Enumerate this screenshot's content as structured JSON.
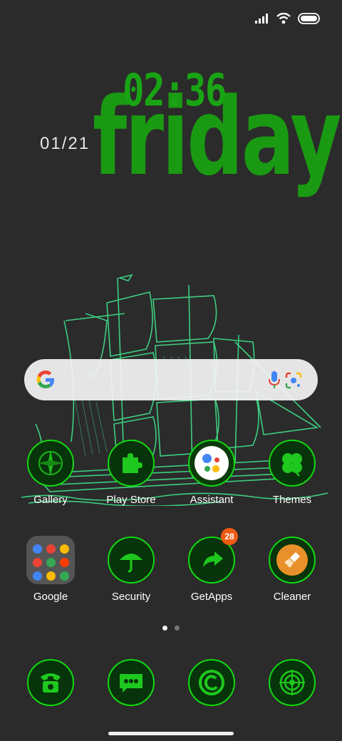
{
  "status_bar": {
    "signal": "signal-icon",
    "wifi": "wifi-icon",
    "battery": "battery-icon"
  },
  "clock": {
    "time": "02:36",
    "day": "friday",
    "date": "01/21"
  },
  "search": {
    "google_icon": "google-g-icon",
    "mic_icon": "mic-icon",
    "lens_icon": "lens-icon"
  },
  "row1": [
    {
      "label": "Gallery",
      "icon": "compass-icon"
    },
    {
      "label": "Play Store",
      "icon": "puzzle-icon"
    },
    {
      "label": "Assistant",
      "icon": "assistant-icon"
    },
    {
      "label": "Themes",
      "icon": "clover-icon"
    }
  ],
  "row2": [
    {
      "label": "Google",
      "icon": "folder-icon"
    },
    {
      "label": "Security",
      "icon": "umbrella-icon"
    },
    {
      "label": "GetApps",
      "icon": "arrow-icon",
      "badge": "28"
    },
    {
      "label": "Cleaner",
      "icon": "brush-icon"
    }
  ],
  "dock": [
    {
      "icon": "phone-icon"
    },
    {
      "icon": "message-icon"
    },
    {
      "icon": "copyright-icon"
    },
    {
      "icon": "radar-icon"
    }
  ],
  "page_indicator": {
    "count": 2,
    "active": 1
  },
  "colors": {
    "accent": "#19a414",
    "ring": "#11d911",
    "badge": "#f05a12",
    "background": "#2b2b2b"
  }
}
